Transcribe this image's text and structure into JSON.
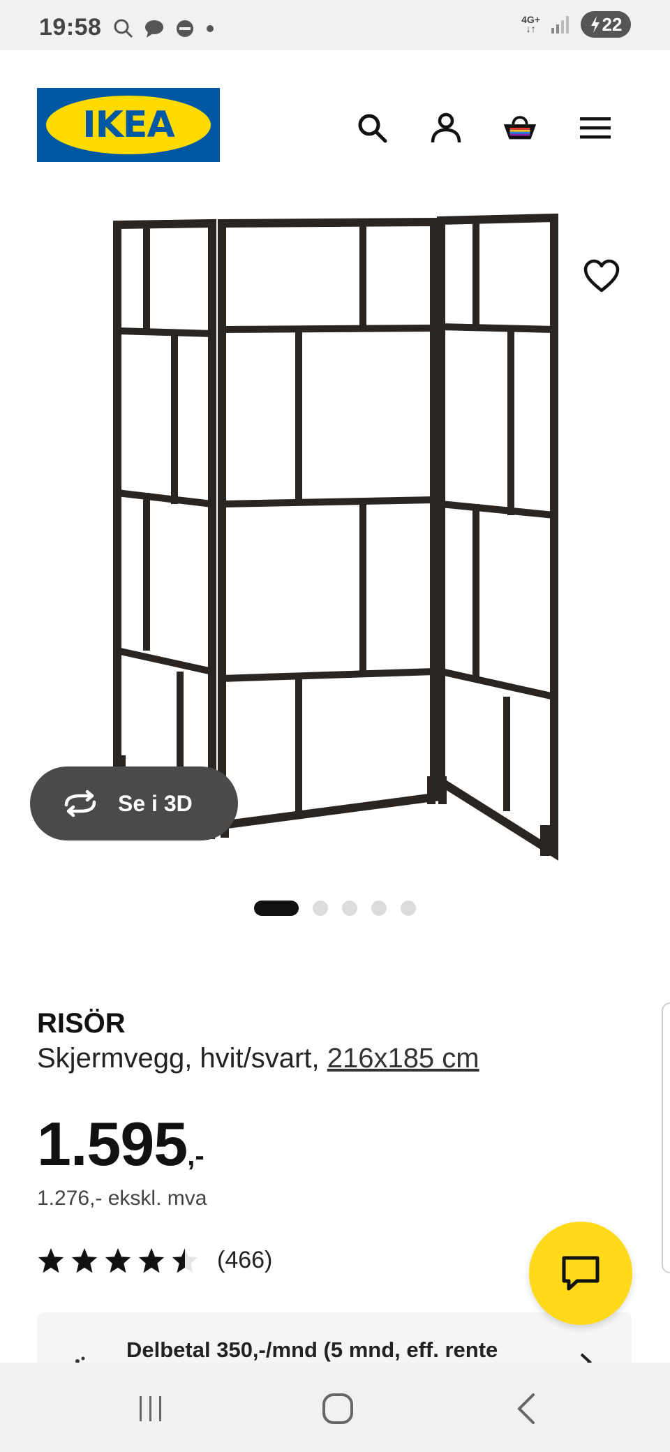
{
  "status_bar": {
    "time": "19:58",
    "network": "4G+",
    "battery": "22"
  },
  "header": {
    "logo_text": "IKEA",
    "icons": [
      "search-icon",
      "account-icon",
      "cart-icon",
      "menu-icon"
    ]
  },
  "gallery": {
    "view_3d_label": "Se i 3D",
    "image_count": 5,
    "active_index": 0
  },
  "product": {
    "name": "RISÖR",
    "description": "Skjermvegg, hvit/svart,",
    "size": "216x185 cm",
    "price": "1.595",
    "price_suffix": ",-",
    "price_ex_vat": "1.276,- ekskl. mva",
    "rating_value": 4.5,
    "rating_count": "(466)"
  },
  "finance": {
    "text": "Delbetal 350,-/mnd (5 mnd, eff. rente"
  },
  "colors": {
    "ikea_blue": "#0058a3",
    "ikea_yellow": "#ffdb00",
    "chat_yellow": "#ffd91a",
    "pill_dark": "#4a4a4a"
  }
}
